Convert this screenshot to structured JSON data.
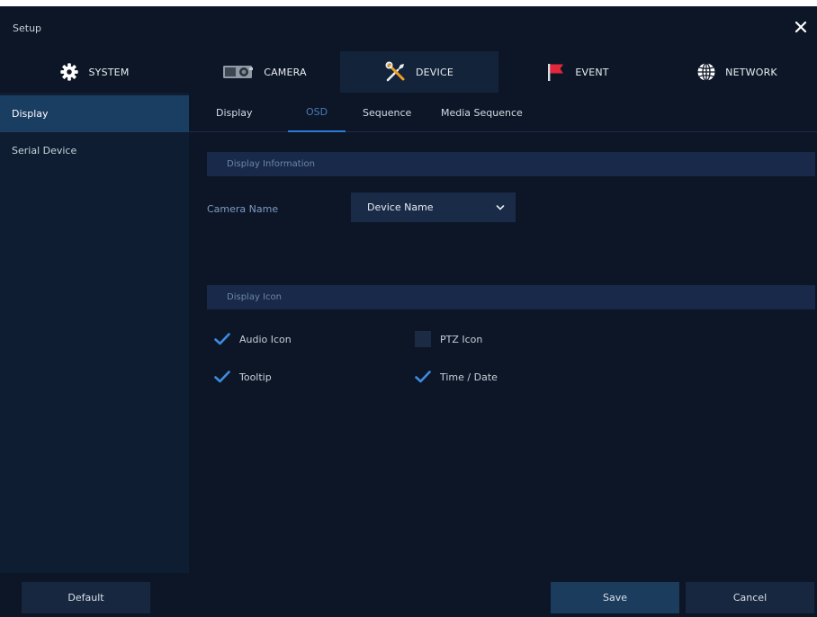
{
  "window": {
    "title": "Setup"
  },
  "tabs": [
    {
      "label": "SYSTEM",
      "icon": "gear-icon"
    },
    {
      "label": "CAMERA",
      "icon": "camera-icon"
    },
    {
      "label": "DEVICE",
      "icon": "tools-icon"
    },
    {
      "label": "EVENT",
      "icon": "flag-icon"
    },
    {
      "label": "NETWORK",
      "icon": "globe-icon"
    }
  ],
  "active_tab": "DEVICE",
  "sidebar": {
    "items": [
      {
        "label": "Display"
      },
      {
        "label": "Serial Device"
      }
    ]
  },
  "subtabs": [
    {
      "label": "Display"
    },
    {
      "label": "OSD"
    },
    {
      "label": "Sequence"
    },
    {
      "label": "Media Sequence"
    }
  ],
  "active_subtab": "OSD",
  "display_info": {
    "header": "Display Information",
    "camera_name_label": "Camera Name",
    "camera_name_value": "Device Name"
  },
  "display_icon": {
    "header": "Display Icon",
    "options": [
      {
        "label": "Audio Icon",
        "checked": true
      },
      {
        "label": "PTZ Icon",
        "checked": false
      },
      {
        "label": "Tooltip",
        "checked": true
      },
      {
        "label": "Time / Date",
        "checked": true
      }
    ]
  },
  "footer": {
    "default_label": "Default",
    "save_label": "Save",
    "cancel_label": "Cancel"
  },
  "colors": {
    "background": "#0c1626",
    "sidebar": "#0e1d31",
    "selected": "#1a3d62",
    "accent": "#2e7bd4",
    "check": "#3d8be0"
  }
}
